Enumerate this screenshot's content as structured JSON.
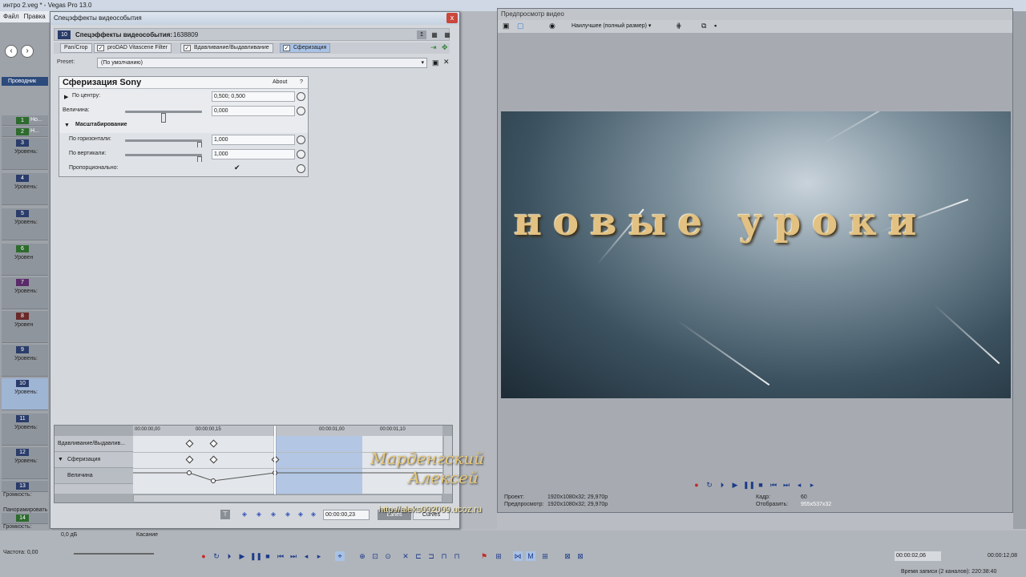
{
  "app": {
    "title": "интро 2.veg * - Vegas Pro 13.0",
    "menu": [
      "Файл",
      "Правка"
    ]
  },
  "tracks": [
    {
      "num": "1",
      "name": "Но...",
      "color": "green"
    },
    {
      "num": "2",
      "name": "Н...",
      "color": "green"
    },
    {
      "num": "3",
      "level": "Уровень:",
      "color": "blue"
    },
    {
      "num": "4",
      "level": "Уровень:",
      "color": "blue"
    },
    {
      "num": "5",
      "level": "Уровень:",
      "color": "blue"
    },
    {
      "num": "6",
      "level": "Уровен",
      "color": "green"
    },
    {
      "num": "7",
      "level": "Уровень:",
      "color": "purple"
    },
    {
      "num": "8",
      "level": "Уровен",
      "color": "red"
    },
    {
      "num": "9",
      "level": "Уровень:",
      "color": "blue"
    },
    {
      "num": "10",
      "level": "Уровень:",
      "color": "blue"
    },
    {
      "num": "11",
      "level": "Уровень:",
      "color": "blue"
    },
    {
      "num": "12",
      "level": "Уровень:",
      "color": "blue"
    },
    {
      "num": "13",
      "level": "Громкость:",
      "color": "blue"
    },
    {
      "num": "14",
      "level": "Громкость:",
      "color": "green"
    }
  ],
  "left_labels": {
    "pan": "Панорамировать",
    "rate": "Частота: 0,00",
    "explorer": "Проводник"
  },
  "fx_window": {
    "title": "Спецэффекты видеособытия",
    "close": "x",
    "header_num": "10",
    "header_label": "Спецэффекты видеособытия:",
    "header_id": "1638809",
    "chain": [
      {
        "label": "Pan/Crop",
        "checked": false,
        "active": false
      },
      {
        "label": "proDAD Vitascene Filter",
        "checked": true,
        "active": false
      },
      {
        "label": "Вдавливание/Выдавливание",
        "checked": true,
        "active": false
      },
      {
        "label": "Сферизация",
        "checked": true,
        "active": true
      }
    ],
    "preset_label": "Preset:",
    "preset_value": "(По умолчанию)",
    "plugin": {
      "title": "Сферизация Sony",
      "about": "About",
      "help": "?",
      "params": {
        "center_label": "По центру:",
        "center_value": "0,500; 0,500",
        "magnitude_label": "Величина:",
        "magnitude_value": "0,000",
        "magnitude_level": 0.5,
        "scaling_group": "Масштабирование",
        "horizontal_label": "По горизонтали:",
        "horizontal_value": "1,000",
        "horizontal_level": 1.0,
        "vertical_label": "По вертикали:",
        "vertical_value": "1,000",
        "vertical_level": 1.0,
        "proportional_label": "Пропорционально:",
        "proportional_checked": true
      }
    },
    "keyframes": {
      "ruler": [
        "00:00:00,00",
        "00:00:00,15",
        "00:00:01,00",
        "00:00:01,15",
        "00:00:01,10"
      ],
      "rows": [
        {
          "name": "Вдавливание/Выдавлив..."
        },
        {
          "name": "Сферизация"
        },
        {
          "name": "Величина"
        }
      ],
      "time": "00:00:00,23",
      "lanes": "Lanes",
      "curves": "Curves"
    }
  },
  "preview": {
    "title": "Предпросмотр видео",
    "quality": "Наилучшее (полный размер)",
    "headline": "новые уроки",
    "info": {
      "project_label": "Проект:",
      "project_value": "1920x1080x32; 29,970p",
      "preview_label": "Предпросмотр:",
      "preview_value": "1920x1080x32; 29,970p",
      "frame_label": "Кадр:",
      "frame_value": "60",
      "display_label": "Отобразить:",
      "display_value": "955x537x32"
    },
    "signature": [
      "Марденгский",
      "Алексей"
    ],
    "url": "http://aleks092009.ucoz.ru"
  },
  "bottom": {
    "level": "0,0 дБ",
    "touch": "Касание",
    "time": "00:00:02,06",
    "time_right": "00:00:12,08",
    "record_info": "Время записи (2 каналов): 220:38:40"
  },
  "colors": {
    "accent": "#3250b5",
    "selection": "#a9c2e6",
    "headline": "#e2c182"
  }
}
